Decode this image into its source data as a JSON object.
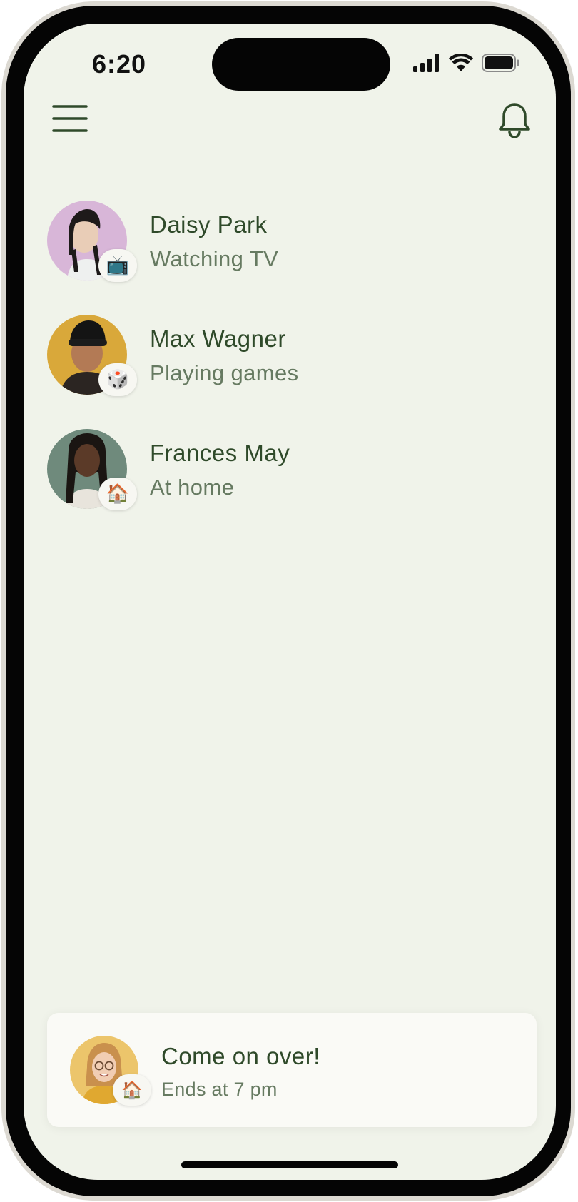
{
  "status_bar": {
    "time": "6:20"
  },
  "header": {
    "menu_icon": "hamburger-menu-icon",
    "notification_icon": "bell-icon"
  },
  "contacts": [
    {
      "name": "Daisy Park",
      "status": "Watching TV",
      "status_emoji": "📺"
    },
    {
      "name": "Max Wagner",
      "status": "Playing games",
      "status_emoji": "🎲"
    },
    {
      "name": "Frances May",
      "status": "At home",
      "status_emoji": "🏠"
    }
  ],
  "invite": {
    "title": "Come on over!",
    "subtitle": "Ends at 7 pm",
    "emoji": "🏠"
  },
  "colors": {
    "background": "#f0f3ea",
    "accent_dark_green": "#2f4a2a",
    "muted_green": "#667a61"
  }
}
